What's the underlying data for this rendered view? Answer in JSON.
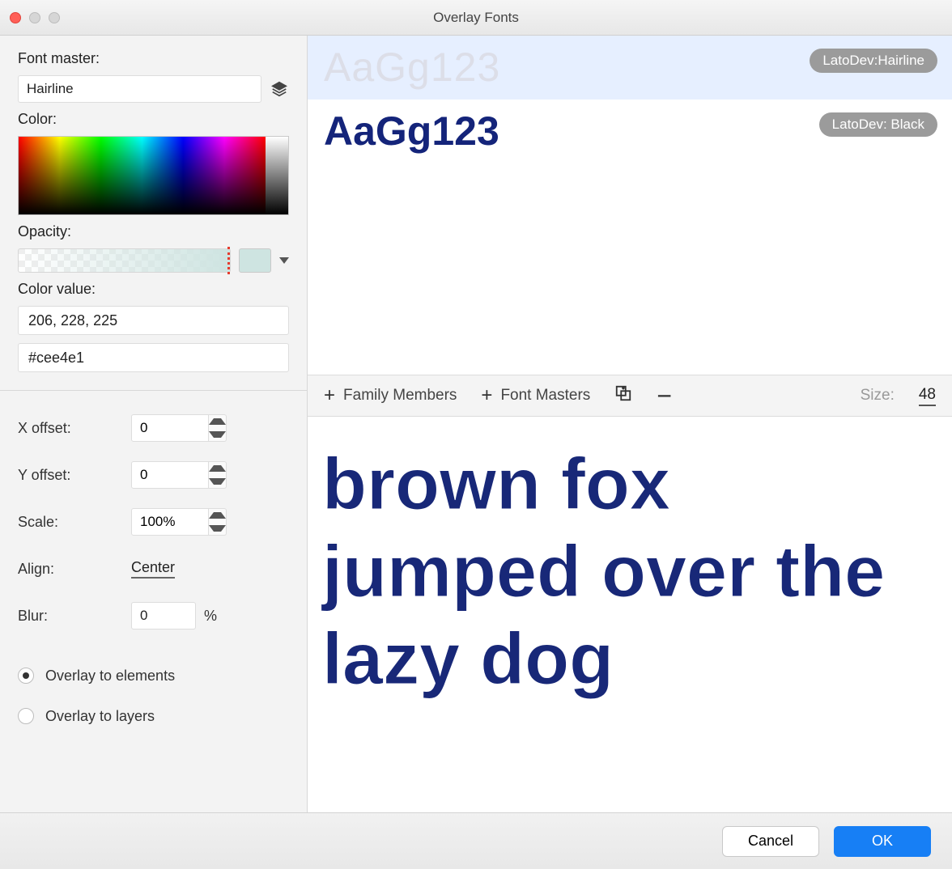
{
  "title": "Overlay Fonts",
  "sidebar": {
    "font_master_label": "Font master:",
    "font_master_value": "Hairline",
    "color_label": "Color:",
    "opacity_label": "Opacity:",
    "color_value_label": "Color value:",
    "color_rgb": "206, 228, 225",
    "color_hex": "#cee4e1",
    "x_offset_label": "X offset:",
    "x_offset": "0",
    "y_offset_label": "Y offset:",
    "y_offset": "0",
    "scale_label": "Scale:",
    "scale": "100%",
    "align_label": "Align:",
    "align_value": "Center",
    "blur_label": "Blur:",
    "blur_value": "0",
    "blur_unit": "%",
    "overlay_elements": "Overlay to elements",
    "overlay_layers": "Overlay to layers"
  },
  "preview": {
    "sample_text": "AaGg123",
    "rows": [
      {
        "name": "LatoDev:Hairline"
      },
      {
        "name": "LatoDev: Black"
      }
    ],
    "toolbar": {
      "family_members": "Family Members",
      "font_masters": "Font Masters",
      "size_label": "Size:",
      "size_value": "48"
    },
    "big_text": "brown fox jumped over the lazy dog"
  },
  "footer": {
    "cancel": "Cancel",
    "ok": "OK"
  }
}
